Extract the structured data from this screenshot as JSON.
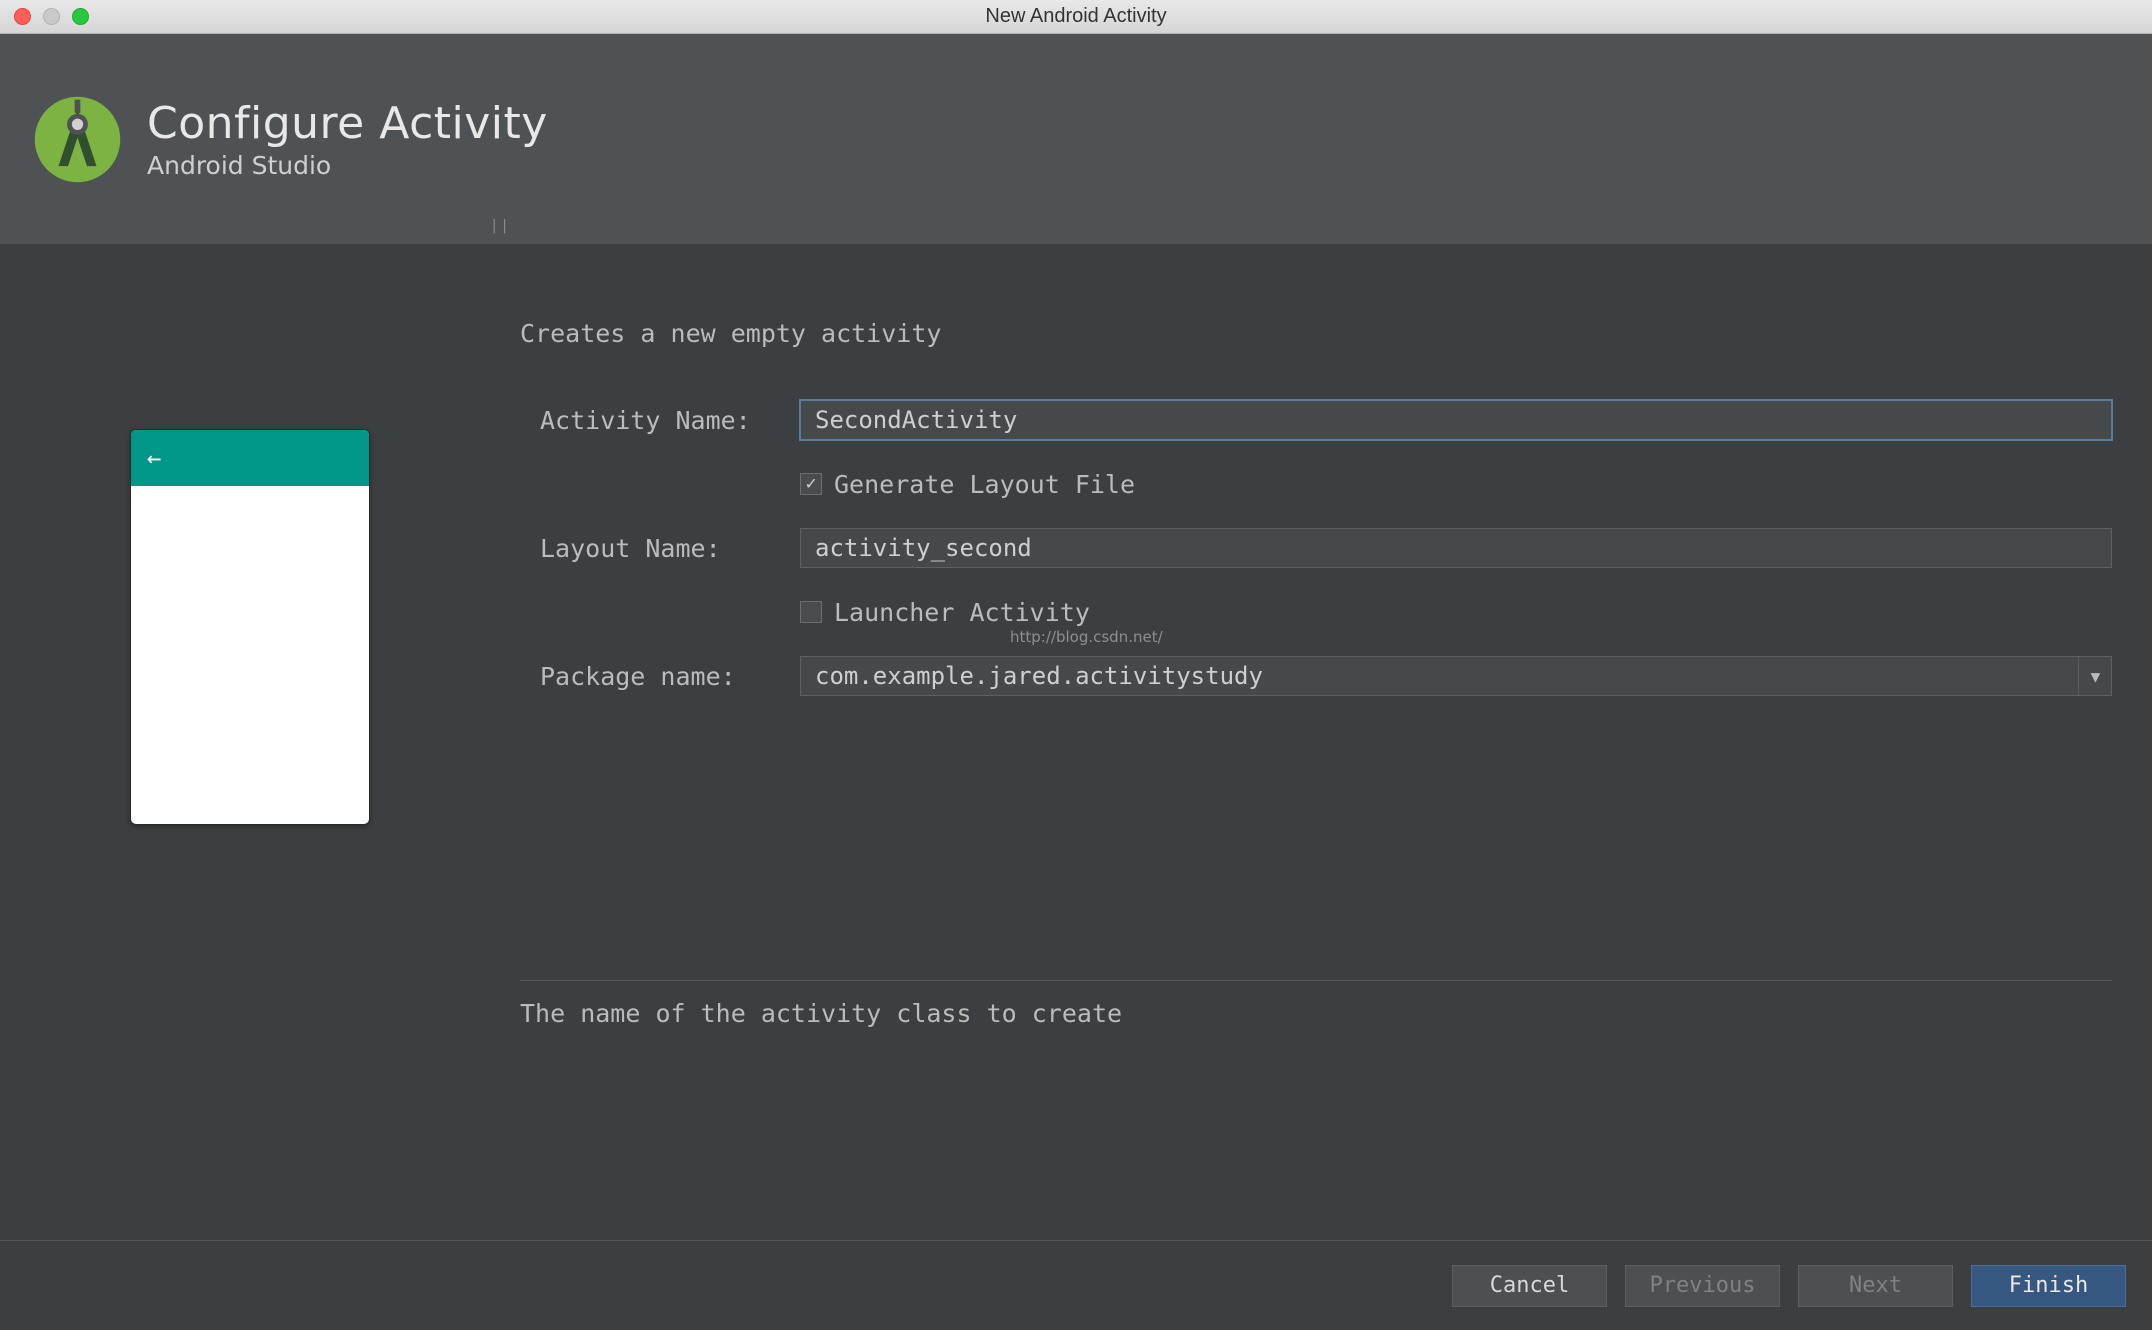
{
  "window": {
    "title": "New Android Activity"
  },
  "header": {
    "title": "Configure Activity",
    "subtitle": "Android Studio"
  },
  "form": {
    "description": "Creates a new empty activity",
    "activity_name_label": "Activity Name:",
    "activity_name_value": "SecondActivity",
    "generate_layout_label": "Generate Layout File",
    "generate_layout_checked": true,
    "layout_name_label": "Layout Name:",
    "layout_name_value": "activity_second",
    "launcher_activity_label": "Launcher Activity",
    "launcher_activity_checked": false,
    "package_name_label": "Package name:",
    "package_name_value": "com.example.jared.activitystudy",
    "help_text": "The name of the activity class to create",
    "watermark": "http://blog.csdn.net/"
  },
  "footer": {
    "cancel": "Cancel",
    "previous": "Previous",
    "next": "Next",
    "finish": "Finish"
  }
}
